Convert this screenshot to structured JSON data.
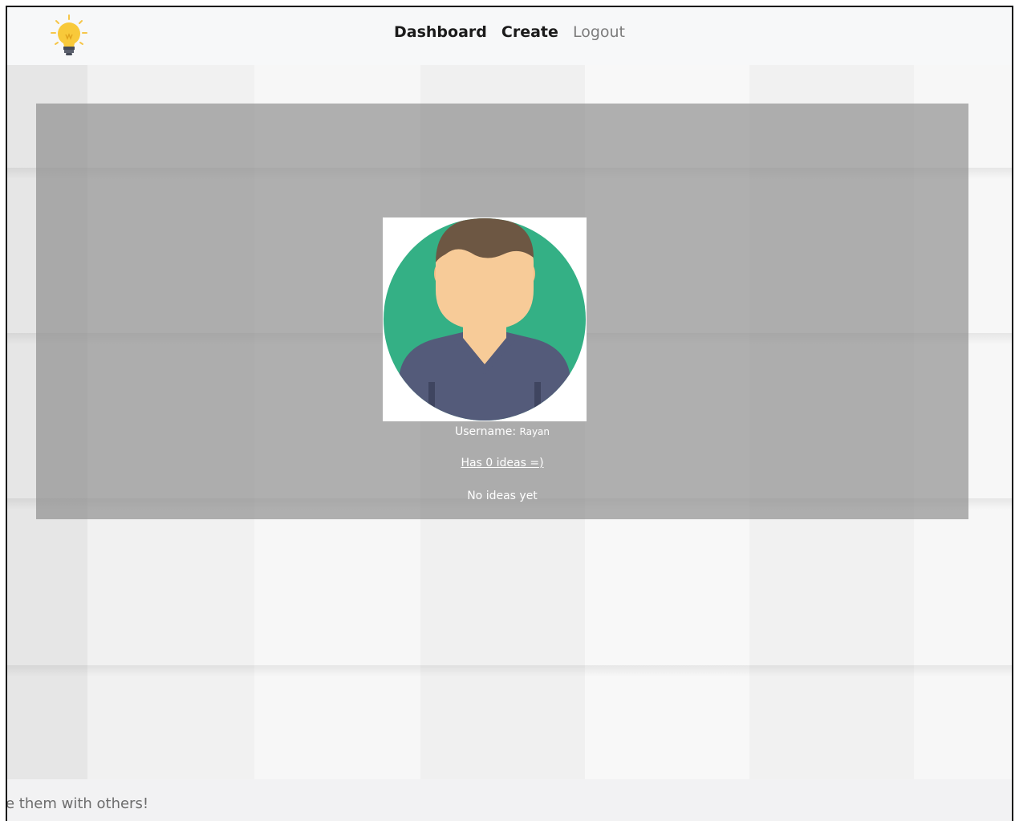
{
  "header": {
    "logo": "lightbulb-icon",
    "nav": {
      "dashboard": "Dashboard",
      "create": "Create",
      "logout": "Logout"
    }
  },
  "profile": {
    "avatar": "user-avatar",
    "username_label": "Username:",
    "username_value": "Rayan",
    "ideas_link": "Has 0 ideas =)",
    "empty_message": "No ideas yet"
  },
  "footer": {
    "tagline": "e them with others!"
  },
  "colors": {
    "panel_overlay": "#8c8c8c",
    "avatar_bg_circle": "#34b085",
    "avatar_skin": "#f7cb98",
    "avatar_hair": "#6d5743",
    "avatar_shirt": "#545b7a",
    "bulb_yellow": "#f8c93a"
  }
}
